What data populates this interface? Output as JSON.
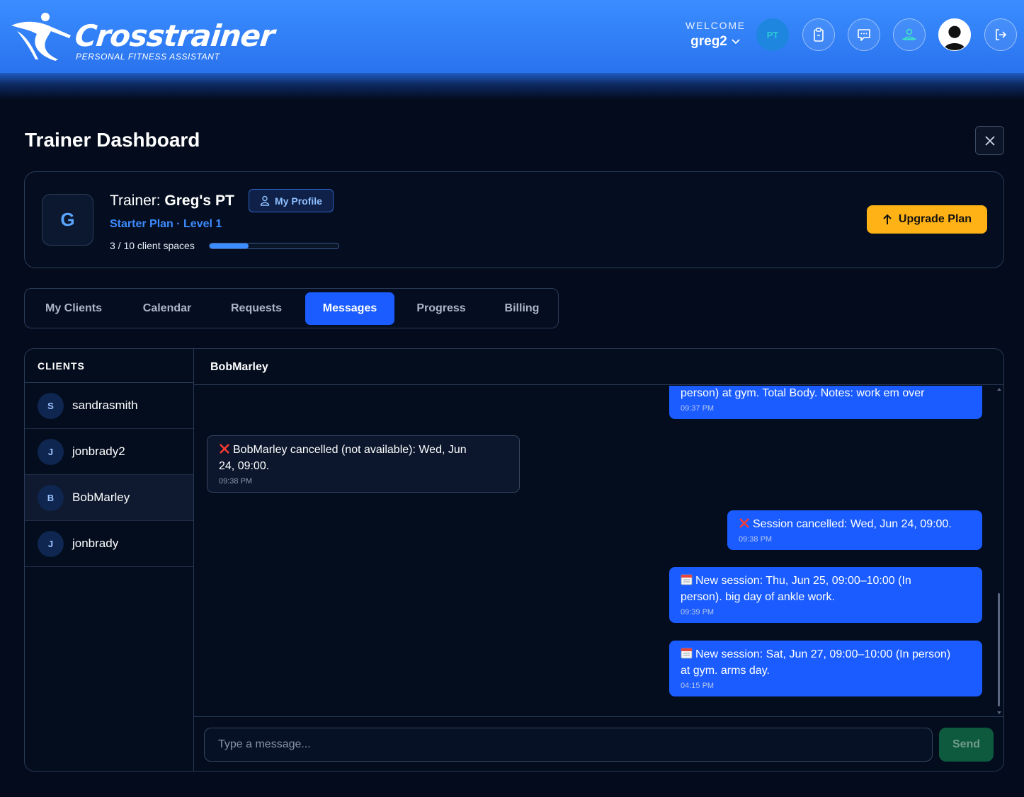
{
  "header": {
    "logo_text": "Crosstrainer",
    "logo_tagline": "PERSONAL FITNESS ASSISTANT",
    "welcome_label": "WELCOME",
    "username": "greg2",
    "pt_badge": "PT",
    "icons": [
      "clipboard-icon",
      "chat-icon",
      "team-icon",
      "user-avatar-icon",
      "logout-icon"
    ]
  },
  "page": {
    "title": "Trainer Dashboard"
  },
  "profile": {
    "initial": "G",
    "trainer_label": "Trainer:",
    "trainer_name": "Greg's PT",
    "my_profile_label": "My Profile",
    "plan": "Starter Plan · Level 1",
    "spaces_text": "3 / 10 client spaces",
    "spaces_used": 3,
    "spaces_total": 10,
    "upgrade_label": "Upgrade Plan"
  },
  "tabs": [
    {
      "label": "My Clients",
      "active": false
    },
    {
      "label": "Calendar",
      "active": false
    },
    {
      "label": "Requests",
      "active": false
    },
    {
      "label": "Messages",
      "active": true
    },
    {
      "label": "Progress",
      "active": false
    },
    {
      "label": "Billing",
      "active": false
    }
  ],
  "clients": {
    "heading": "CLIENTS",
    "items": [
      {
        "initial": "S",
        "name": "sandrasmith",
        "active": false
      },
      {
        "initial": "J",
        "name": "jonbrady2",
        "active": false
      },
      {
        "initial": "B",
        "name": "BobMarley",
        "active": true
      },
      {
        "initial": "J",
        "name": "jonbrady",
        "active": false
      }
    ]
  },
  "chat": {
    "contact": "BobMarley",
    "messages": [
      {
        "direction": "out",
        "icon": "",
        "line1": "person) at gym. Total Body. Notes: work em over",
        "line2": "",
        "time": "09:37 PM"
      },
      {
        "direction": "in",
        "icon": "cross-mark-icon",
        "line1": "BobMarley cancelled (not available): Wed, Jun",
        "line2": "24, 09:00.",
        "time": "09:38 PM"
      },
      {
        "direction": "out",
        "icon": "cross-mark-icon",
        "line1": "Session cancelled: Wed, Jun 24, 09:00.",
        "line2": "",
        "time": "09:38 PM"
      },
      {
        "direction": "out",
        "icon": "calendar-icon",
        "line1": "New session: Thu, Jun 25, 09:00–10:00 (In",
        "line2": "person). big day of ankle work.",
        "time": "09:39 PM"
      },
      {
        "direction": "out",
        "icon": "calendar-icon",
        "line1": "New session: Sat, Jun 27, 09:00–10:00 (In person)",
        "line2": "at gym. arms day.",
        "time": "04:15 PM"
      }
    ],
    "input_placeholder": "Type a message...",
    "send_label": "Send"
  },
  "colors": {
    "header": "#2f80f7",
    "accent": "#1a5cff",
    "upgrade": "#ffb216",
    "background": "#030b1c"
  }
}
